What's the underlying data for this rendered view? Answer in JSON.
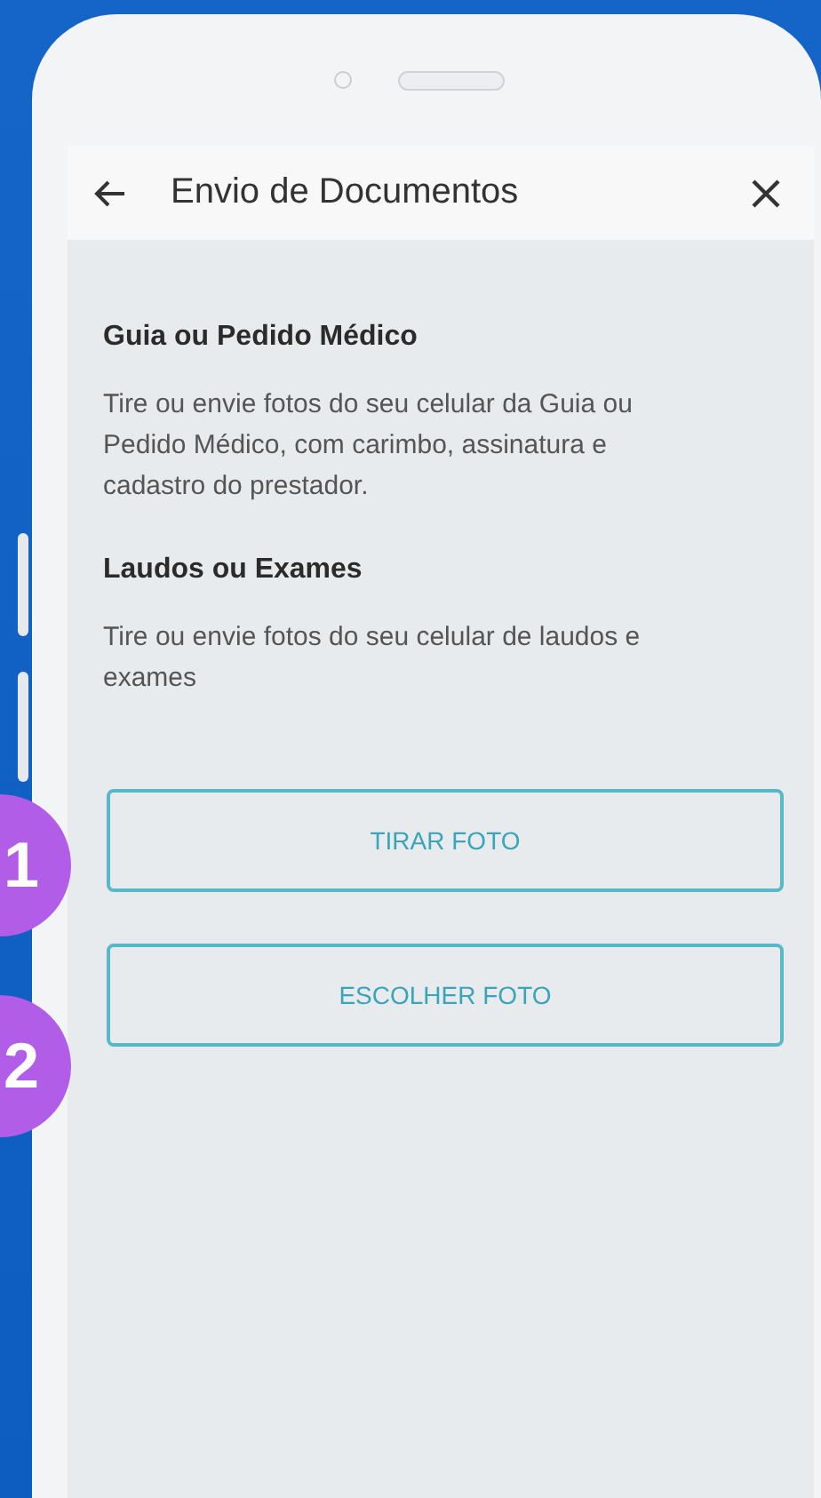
{
  "header": {
    "title": "Envio de Documentos"
  },
  "sections": [
    {
      "heading": "Guia ou Pedido Médico",
      "text": "Tire ou envie fotos do seu celular da Guia ou Pedido Médico, com carimbo, assinatura e cadastro do prestador."
    },
    {
      "heading": "Laudos ou Exames",
      "text": "Tire ou envie fotos do seu celular de laudos e exames"
    }
  ],
  "buttons": [
    {
      "label": "TIRAR FOTO",
      "badge": "1"
    },
    {
      "label": "ESCOLHER FOTO",
      "badge": "2"
    }
  ]
}
